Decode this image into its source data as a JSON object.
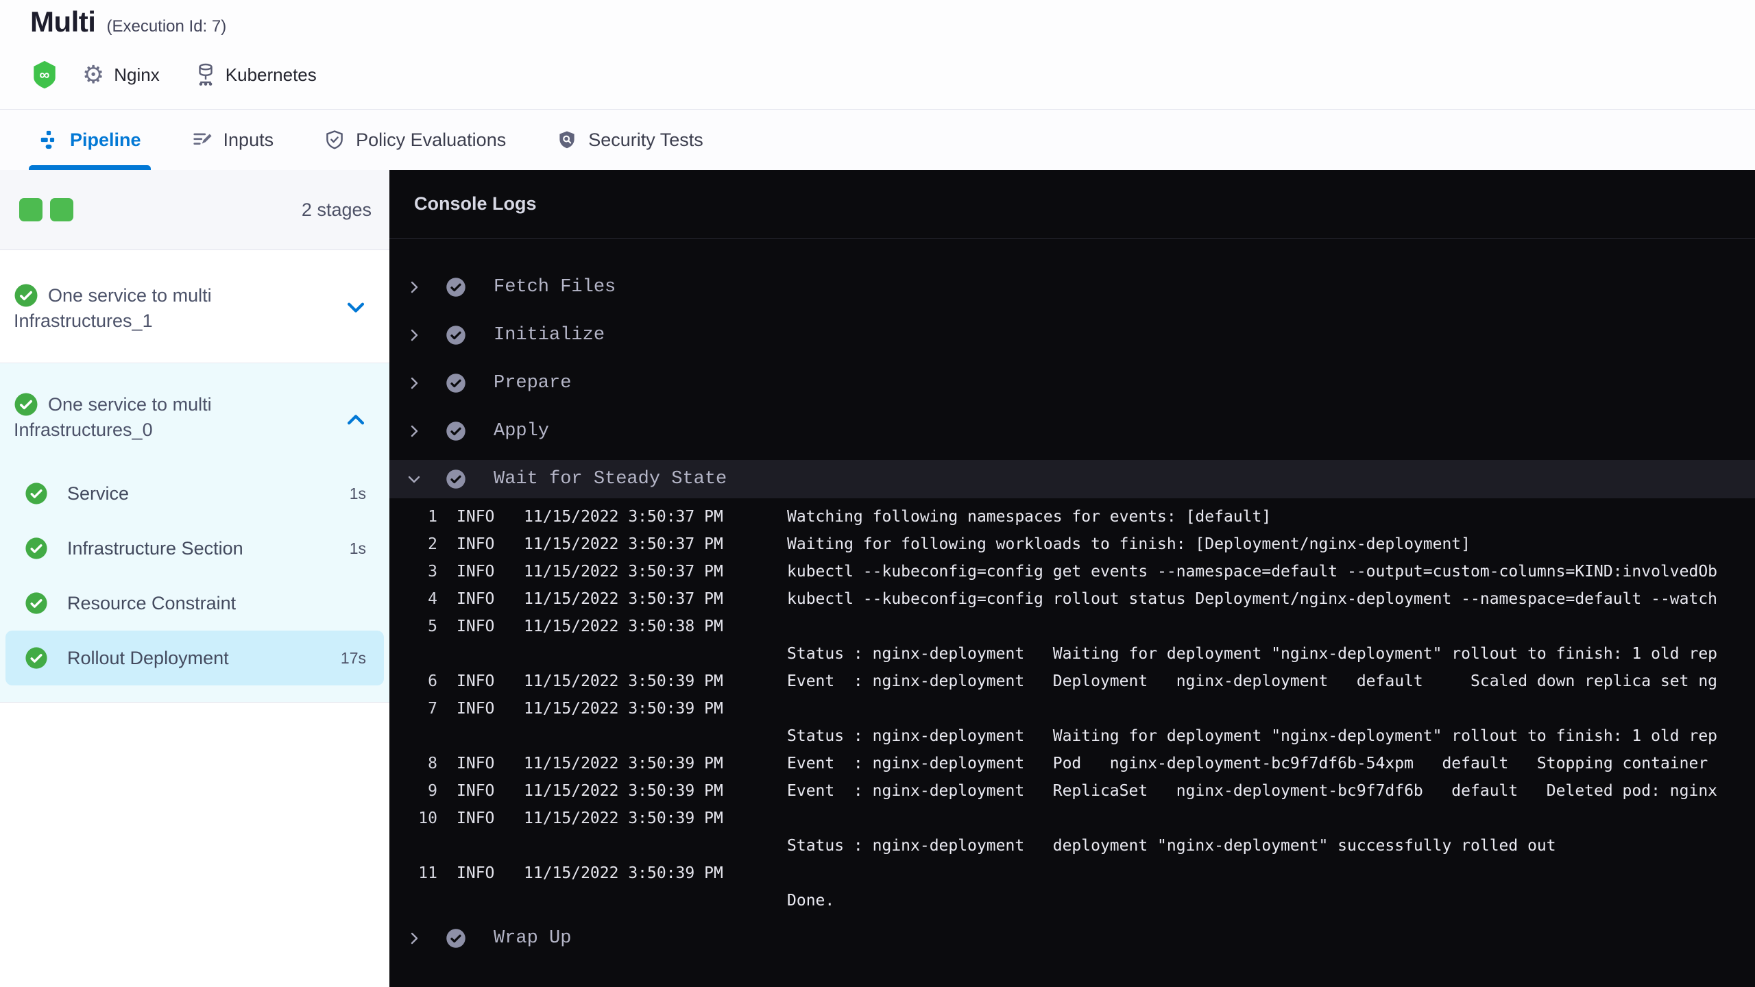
{
  "header": {
    "title": "Multi",
    "execution_id": "(Execution Id: 7)",
    "service_label": "Nginx",
    "infra_label": "Kubernetes"
  },
  "tabs": [
    {
      "label": "Pipeline",
      "active": true
    },
    {
      "label": "Inputs",
      "active": false
    },
    {
      "label": "Policy Evaluations",
      "active": false
    },
    {
      "label": "Security Tests",
      "active": false
    }
  ],
  "sidebar": {
    "stage_count": "2 stages",
    "stage_squares": 2,
    "stages": [
      {
        "name": "One service to multi Infrastructures_1",
        "status": "success",
        "expanded": false
      },
      {
        "name": "One service to multi Infrastructures_0",
        "status": "success",
        "expanded": true,
        "steps": [
          {
            "label": "Service",
            "duration": "1s",
            "selected": false
          },
          {
            "label": "Infrastructure Section",
            "duration": "1s",
            "selected": false
          },
          {
            "label": "Resource Constraint",
            "duration": "",
            "selected": false
          },
          {
            "label": "Rollout Deployment",
            "duration": "17s",
            "selected": true
          }
        ]
      }
    ]
  },
  "console": {
    "title": "Console Logs",
    "steps_before": [
      "Fetch Files",
      "Initialize",
      "Prepare",
      "Apply"
    ],
    "expanded_step": "Wait for Steady State",
    "steps_after": [
      "Wrap Up"
    ],
    "logs": [
      {
        "num": "1",
        "level": "INFO",
        "time": "11/15/2022 3:50:37 PM",
        "msg": "Watching following namespaces for events: [default]"
      },
      {
        "num": "2",
        "level": "INFO",
        "time": "11/15/2022 3:50:37 PM",
        "msg": "Waiting for following workloads to finish: [Deployment/nginx-deployment]"
      },
      {
        "num": "3",
        "level": "INFO",
        "time": "11/15/2022 3:50:37 PM",
        "msg": "kubectl --kubeconfig=config get events --namespace=default --output=custom-columns=KIND:involvedOb"
      },
      {
        "num": "4",
        "level": "INFO",
        "time": "11/15/2022 3:50:37 PM",
        "msg": "kubectl --kubeconfig=config rollout status Deployment/nginx-deployment --namespace=default --watch"
      },
      {
        "num": "5",
        "level": "INFO",
        "time": "11/15/2022 3:50:38 PM",
        "msg": ""
      },
      {
        "num": "",
        "level": "",
        "time": "",
        "msg": "Status : nginx-deployment   Waiting for deployment \"nginx-deployment\" rollout to finish: 1 old rep"
      },
      {
        "num": "6",
        "level": "INFO",
        "time": "11/15/2022 3:50:39 PM",
        "msg": "Event  : nginx-deployment   Deployment   nginx-deployment   default     Scaled down replica set ng"
      },
      {
        "num": "7",
        "level": "INFO",
        "time": "11/15/2022 3:50:39 PM",
        "msg": ""
      },
      {
        "num": "",
        "level": "",
        "time": "",
        "msg": "Status : nginx-deployment   Waiting for deployment \"nginx-deployment\" rollout to finish: 1 old rep"
      },
      {
        "num": "8",
        "level": "INFO",
        "time": "11/15/2022 3:50:39 PM",
        "msg": "Event  : nginx-deployment   Pod   nginx-deployment-bc9f7df6b-54xpm   default   Stopping container"
      },
      {
        "num": "9",
        "level": "INFO",
        "time": "11/15/2022 3:50:39 PM",
        "msg": "Event  : nginx-deployment   ReplicaSet   nginx-deployment-bc9f7df6b   default   Deleted pod: nginx"
      },
      {
        "num": "10",
        "level": "INFO",
        "time": "11/15/2022 3:50:39 PM",
        "msg": ""
      },
      {
        "num": "",
        "level": "",
        "time": "",
        "msg": "Status : nginx-deployment   deployment \"nginx-deployment\" successfully rolled out"
      },
      {
        "num": "11",
        "level": "INFO",
        "time": "11/15/2022 3:50:39 PM",
        "msg": ""
      },
      {
        "num": "",
        "level": "",
        "time": "",
        "msg": "Done."
      }
    ]
  },
  "icons": {
    "harness_logo": "green-hexagon-infinity",
    "service": "gear",
    "infrastructure": "server-stack",
    "tab_pipeline": "pipeline",
    "tab_inputs": "edit-lines",
    "tab_policy": "shield-check",
    "tab_security": "shield-magnifier",
    "stage_status": "check-circle",
    "collapse_expand": "chevron"
  },
  "colors": {
    "accent_blue": "#0278d5",
    "success_green": "#42ab45",
    "stage_square_green": "#4dbb50",
    "selected_step_bg": "#cdeffc",
    "stage_group_bg": "#edfafd",
    "console_bg": "#0b0b0e",
    "expanded_row_bg": "#1d1d25"
  }
}
